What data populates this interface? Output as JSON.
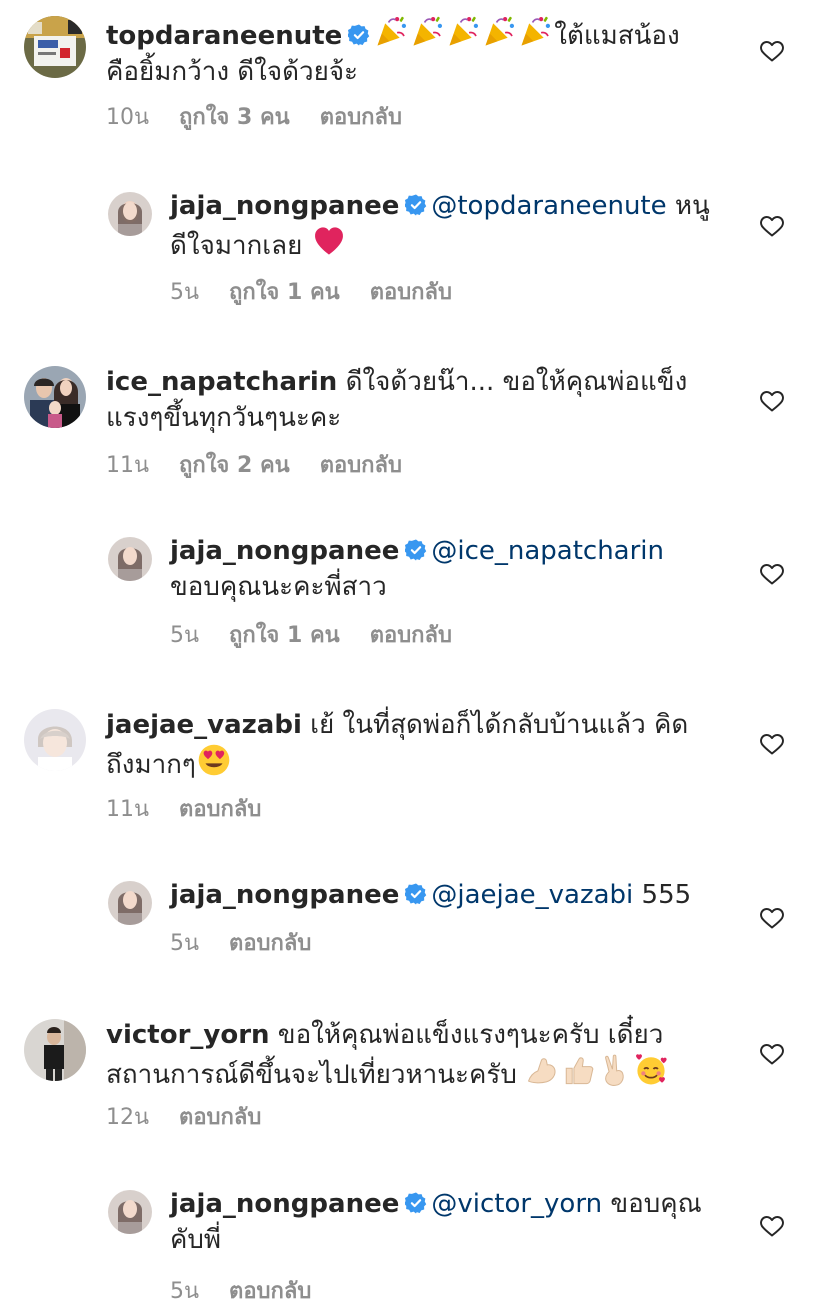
{
  "comments": [
    {
      "username": "topdaraneenute",
      "verified": true,
      "text": "ใต้แมสน้องคือยิ้มกว้าง ดีใจด้วยจ้ะ",
      "text_prefix_emoji": "party-popper x5",
      "time": "10น",
      "likes": "ถูกใจ 3 คน",
      "reply": "ตอบกลับ"
    },
    {
      "username": "jaja_nongpanee",
      "verified": true,
      "mention": "@topdaraneenute",
      "text": "หนูดีใจมากเลย",
      "text_suffix_emoji": "red-heart",
      "time": "5น",
      "likes": "ถูกใจ 1 คน",
      "reply": "ตอบกลับ"
    },
    {
      "username": "ice_napatcharin",
      "verified": false,
      "text": "ดีใจด้วยน๊า... ขอให้คุณพ่อแข็งแรงๆขึ้นทุกวันๆนะคะ",
      "time": "11น",
      "likes": "ถูกใจ 2 คน",
      "reply": "ตอบกลับ"
    },
    {
      "username": "jaja_nongpanee",
      "verified": true,
      "mention": "@ice_napatcharin",
      "text": "ขอบคุณนะคะพี่สาว",
      "time": "5น",
      "likes": "ถูกใจ 1 คน",
      "reply": "ตอบกลับ"
    },
    {
      "username": "jaejae_vazabi",
      "verified": false,
      "text": "เย้ ในที่สุดพ่อก็ได้กลับบ้านแล้ว คิดถึงมากๆ",
      "text_suffix_emoji": "heart-eyes",
      "time": "11น",
      "reply": "ตอบกลับ"
    },
    {
      "username": "jaja_nongpanee",
      "verified": true,
      "mention": "@jaejae_vazabi",
      "text": "555",
      "time": "5น",
      "reply": "ตอบกลับ"
    },
    {
      "username": "victor_yorn",
      "verified": false,
      "text": "ขอให้คุณพ่อแข็งแรงๆนะครับ เดี๋ยวสถานการณ์ดีขึ้นจะไปเที่ยวหานะครับ",
      "text_suffix_emoji": "muscle thumbs-up victory smiling-hearts",
      "time": "12น",
      "reply": "ตอบกลับ"
    },
    {
      "username": "jaja_nongpanee",
      "verified": true,
      "mention": "@victor_yorn",
      "text": "ขอบคุณคับพี่",
      "time": "5น",
      "reply": "ตอบกลับ"
    }
  ],
  "colors": {
    "text": "#262626",
    "meta": "#8e8e8e",
    "mention": "#00376b",
    "verified": "#3897f0",
    "heart_emoji": "#e0245e"
  },
  "icons": {
    "like": "heart-outline-icon",
    "verified": "verified-badge-icon"
  }
}
